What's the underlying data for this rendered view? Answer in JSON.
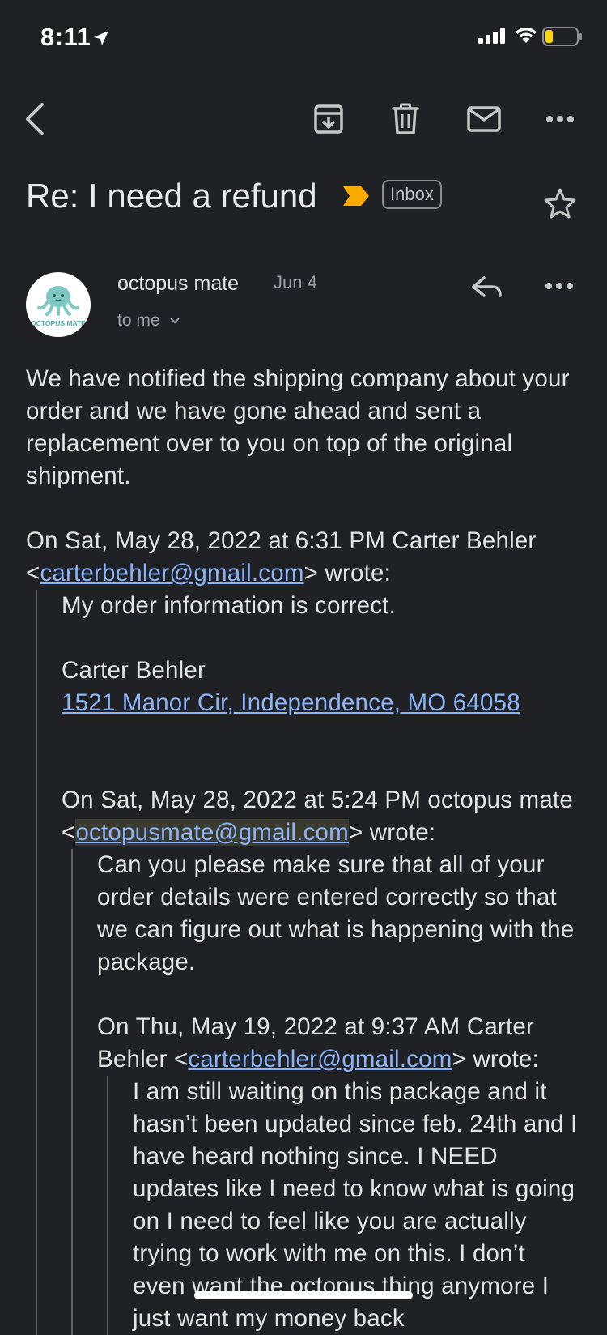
{
  "status_bar": {
    "time": "8:11",
    "battery_level": 0.2,
    "battery_color": "#ffd60a"
  },
  "toolbar": {
    "back_icon": "back-arrow-icon",
    "archive_icon": "archive-icon",
    "delete_icon": "trash-icon",
    "mark_unread_icon": "mail-icon",
    "more_icon": "more-horizontal-icon"
  },
  "subject": {
    "title": "Re: I need a refund",
    "label": "Inbox",
    "importance_color": "#f9ab00"
  },
  "message": {
    "sender": "octopus mate",
    "date": "Jun 4",
    "to": "to me",
    "avatar_text": "OCTOPUS MATE",
    "body": "We have notified the shipping company about your order and we have gone ahead and sent a replacement over to you on top of the original shipment.",
    "quote1": {
      "header_prefix": "On Sat, May 28, 2022 at 6:31 PM Carter Behler <",
      "email": "carterbehler@gmail.com",
      "header_suffix": "> wrote:",
      "line1": "My order information is correct.",
      "name": "Carter Behler",
      "address": "1521 Manor Cir, Independence, MO 64058"
    },
    "quote2": {
      "header_prefix": "On Sat, May 28, 2022 at 5:24 PM octopus mate <",
      "email": "octopusmate@gmail.com",
      "header_suffix": "> wrote:",
      "text": "Can you please make sure that all of your order details were entered correctly so that we can figure out what is happening with the package."
    },
    "quote3": {
      "header_prefix": "On Thu, May 19, 2022 at 9:37 AM Carter Behler <",
      "email": "carterbehler@gmail.com",
      "header_suffix": "> wrote:",
      "text": "I am still waiting on this package and it hasn’t been updated since feb. 24th and I have heard nothing since. I NEED updates like I need to know what is going on I need to feel like you are actually trying to work with me on this. I don’t even want the octopus thing anymore I just want my money back"
    }
  }
}
